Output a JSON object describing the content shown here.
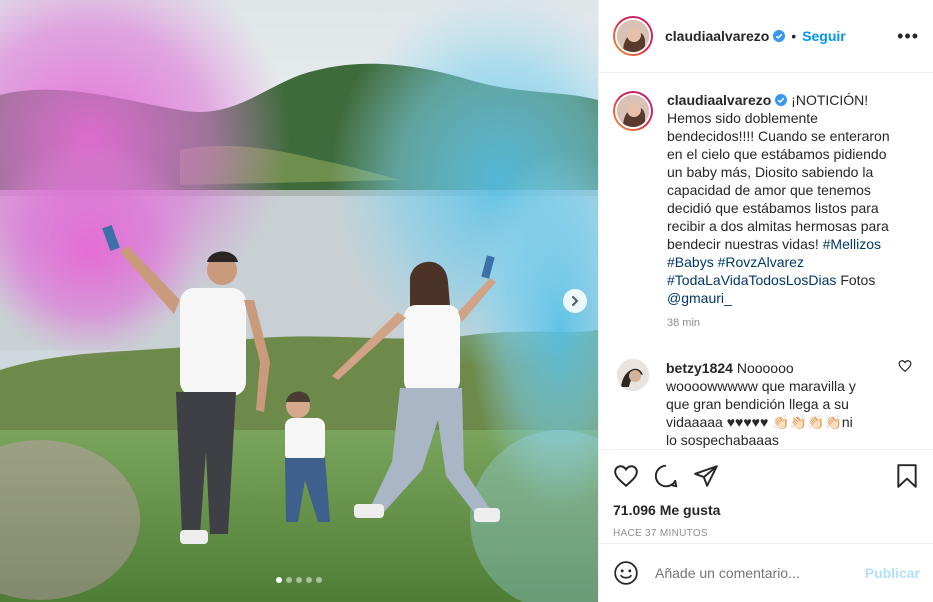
{
  "post": {
    "username": "claudiaalvarezo",
    "verified_icon": "verified-badge-icon",
    "separator": "•",
    "follow_label": "Seguir",
    "more_label": "•••"
  },
  "caption": {
    "username": "claudiaalvarezo",
    "text_before": " ¡NOTICIÓN! Hemos sido doblemente bendecidos!!!! Cuando se enteraron en el cielo que estábamos pidiendo un baby más, Diosito sabiendo la capacidad de amor que tenemos decidió que estábamos listos para recibir a dos almitas hermosas para bendecir nuestras vidas! ",
    "tag1": "#Mellizos",
    "tag2": "#Babys",
    "tag3": "#RovzAlvarez",
    "tag4": "#TodaLaVidaTodosLosDias",
    "fotos": "Fotos ",
    "mention": "@gmauri_",
    "time": "38 min"
  },
  "comment": {
    "username": "betzy1824",
    "text": " Noooooo woooowwwww que maravilla y que gran bendición llega a su vidaaaaa ♥♥♥♥♥ 👏🏻👏🏻👏🏻👏🏻ni lo sospechabaaas"
  },
  "footer": {
    "likes": "71.096 Me gusta",
    "time_ago": "HACE 37 MINUTOS",
    "comment_placeholder": "Añade un comentario...",
    "post_label": "Publicar"
  },
  "carousel": {
    "total_slides": 5,
    "current_slide": 1
  },
  "colors": {
    "accent": "#0095f6",
    "post_disabled": "#b2dffc",
    "hashtag": "#00376b",
    "muted": "#8e8e8e"
  }
}
